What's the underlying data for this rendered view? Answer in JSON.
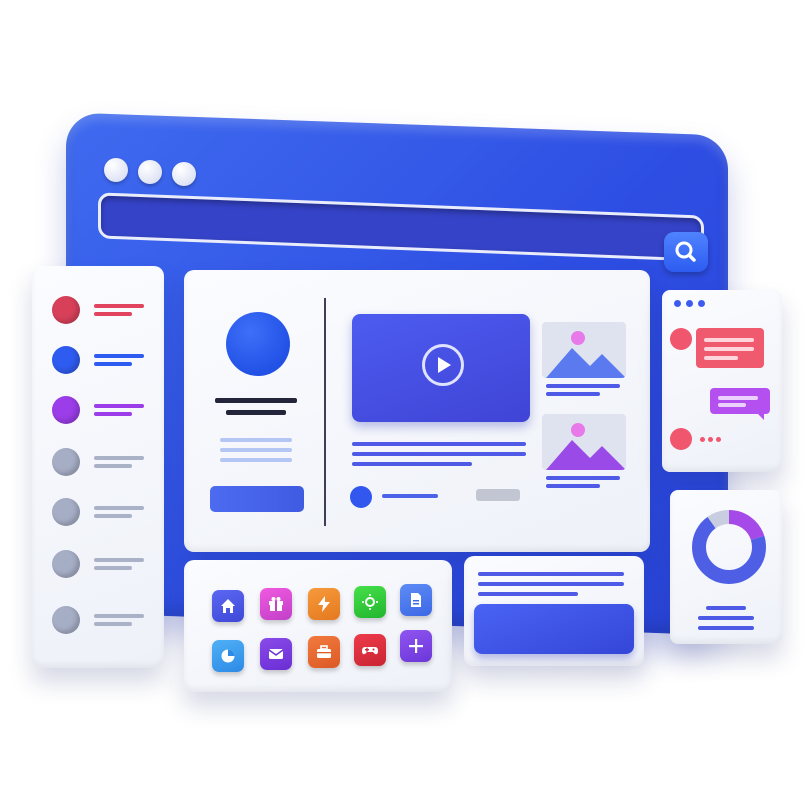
{
  "colors": {
    "browser_blue": "#2e4ee3",
    "accent_red": "#e0445e",
    "accent_blue": "#2f5cf0",
    "accent_purple": "#9b3de8",
    "neutral_gray": "#a6aec6",
    "chat_red": "#f05a6e",
    "chat_purple": "#b450f0"
  },
  "icons": {
    "search": "search-icon",
    "play": "play-icon",
    "image": "image-icon",
    "apps": [
      "home-icon",
      "gift-icon",
      "bolt-icon",
      "sun-icon",
      "document-icon",
      "pie-chart-icon",
      "mail-icon",
      "briefcase-icon",
      "gamepad-icon",
      "plus-icon"
    ]
  },
  "chart_data": {
    "type": "donut",
    "segments": [
      {
        "share": 0.2,
        "color": "#a54ae8"
      },
      {
        "share": 0.7,
        "color": "#4e5fe6"
      },
      {
        "share": 0.1,
        "color": "#c9cde0"
      }
    ]
  }
}
